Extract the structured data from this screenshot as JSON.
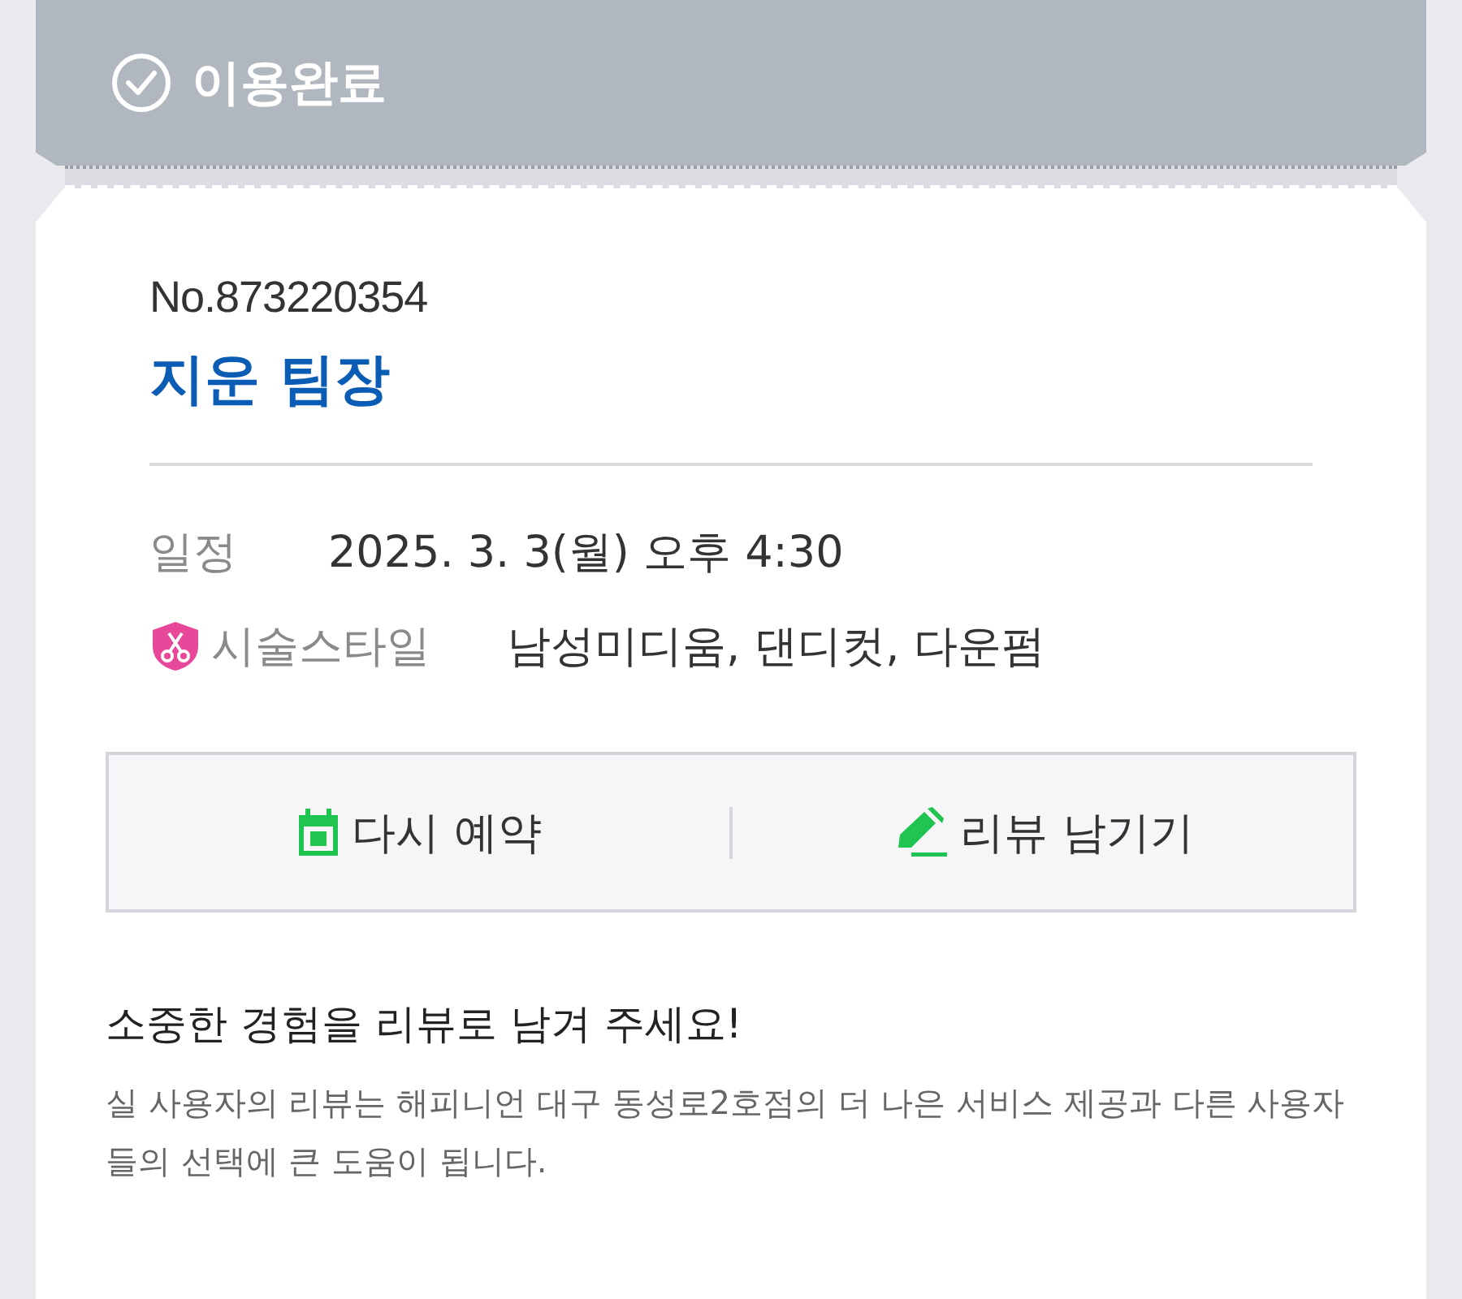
{
  "status": {
    "label": "이용완료"
  },
  "booking": {
    "number": "No.873220354",
    "designer": "지운 팀장"
  },
  "details": [
    {
      "kind": "plain",
      "label": "일정",
      "value": "2025. 3. 3(월) 오후 4:30"
    },
    {
      "kind": "style",
      "label": "시술스타일",
      "value": "남성미디움, 댄디컷, 다운펌"
    }
  ],
  "actions": [
    {
      "kind": "calendar",
      "label": "다시 예약"
    },
    {
      "kind": "pencil",
      "label": "리뷰 남기기"
    }
  ],
  "review_prompt": {
    "title": "소중한 경험을 리뷰로 남겨 주세요!",
    "body": "실 사용자의 리뷰는 해피니언 대구 동성로2호점의 더 나은 서비스 제공과 다른 사용자들의 선택에 큰 도움이 됩니다."
  }
}
